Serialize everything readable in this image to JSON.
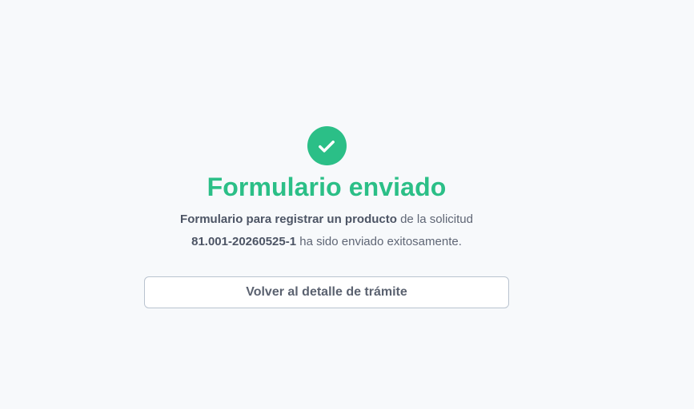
{
  "status": {
    "icon": "check-circle-icon",
    "title": "Formulario enviado",
    "accent_color": "#2bbf87"
  },
  "message": {
    "form_name": "Formulario para registrar un producto",
    "middle_text": "de la solicitud",
    "request_id": "81.001-20260525-1",
    "ending_text": "ha sido enviado exitosamente."
  },
  "actions": {
    "back_button_label": "Volver al detalle de trámite"
  }
}
